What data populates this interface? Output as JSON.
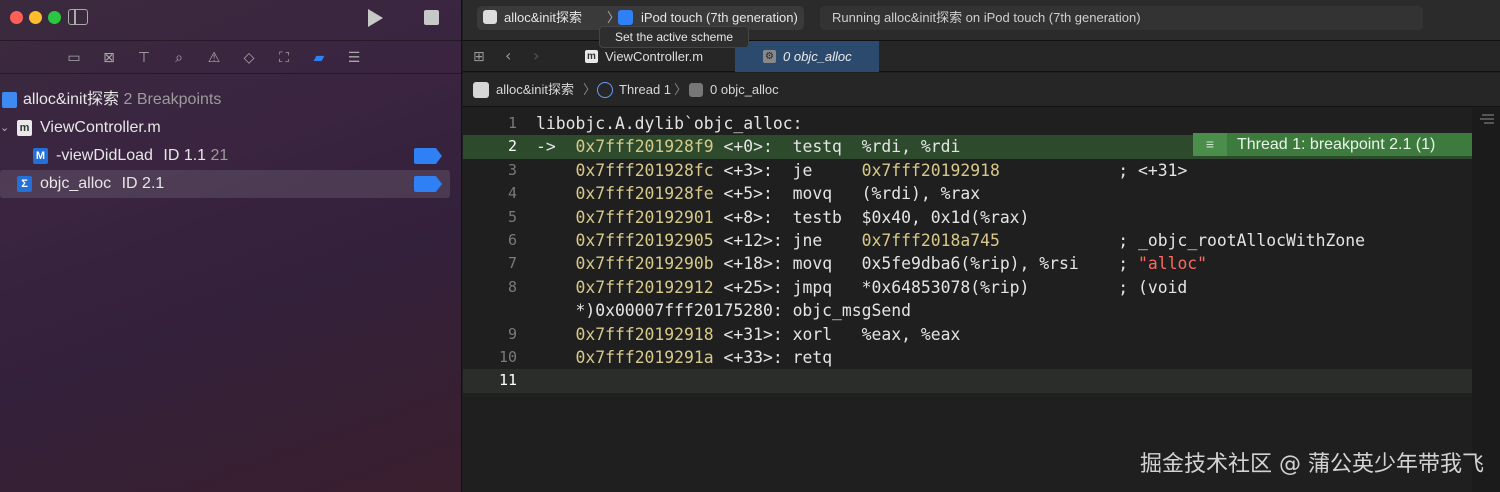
{
  "window": {
    "title": "alloc&init探索"
  },
  "navigator": {
    "toolbar_icons": [
      "folder-icon",
      "source-control-icon",
      "hierarchy-icon",
      "search-icon",
      "issue-warning-icon",
      "test-diamond-icon",
      "debug-spray-icon",
      "breakpoint-navigator-icon",
      "report-icon"
    ],
    "project": {
      "name": "alloc&init探索",
      "subtitle": "2 Breakpoints"
    },
    "file": {
      "name": "ViewController.m"
    },
    "breakpoints": [
      {
        "method": "-viewDidLoad",
        "id": "ID 1.1",
        "line": "21"
      },
      {
        "method": "objc_alloc",
        "id": "ID 2.1",
        "line": ""
      }
    ]
  },
  "toolbar": {
    "scheme": "alloc&init探索",
    "separator": "〉",
    "device": "iPod touch (7th generation)",
    "status": "Running alloc&init探索 on iPod touch (7th generation)",
    "tooltip": "Set the active scheme"
  },
  "tabs": [
    {
      "label": "ViewController.m",
      "active": false
    },
    {
      "label": "0 objc_alloc",
      "active": true
    }
  ],
  "jump_bar": {
    "project": "alloc&init探索",
    "thread": "Thread 1",
    "frame": "0 objc_alloc",
    "sep": "〉"
  },
  "code": {
    "lines": [
      {
        "n": "1",
        "text": "libobjc.A.dylib`objc_alloc:"
      },
      {
        "n": "2",
        "arrow": "->",
        "addr": "0x7fff201928f9",
        "rest": " <+0>:  testq  %rdi, %rdi"
      },
      {
        "n": "3",
        "addr": "0x7fff201928fc",
        "rest": " <+3>:  je     ",
        "addr2": "0x7fff20192918",
        "rest2": "            ; <+31>"
      },
      {
        "n": "4",
        "addr": "0x7fff201928fe",
        "rest": " <+5>:  movq   (%rdi), %rax"
      },
      {
        "n": "5",
        "addr": "0x7fff20192901",
        "rest": " <+8>:  testb  $0x40, 0x1d(%rax)"
      },
      {
        "n": "6",
        "addr": "0x7fff20192905",
        "rest": " <+12>: jne    ",
        "addr2": "0x7fff2018a745",
        "rest2": "            ; _objc_rootAllocWithZone"
      },
      {
        "n": "7",
        "addr": "0x7fff2019290b",
        "rest": " <+18>: movq   0x5fe9dba6(%rip), %rsi    ; ",
        "str": "\"alloc\""
      },
      {
        "n": "8",
        "addr": "0x7fff20192912",
        "rest": " <+25>: jmpq   *0x64853078(%rip)         ; (void"
      },
      {
        "n": "",
        "cont": "    *)0x00007fff20175280: objc_msgSend"
      },
      {
        "n": "9",
        "addr": "0x7fff20192918",
        "rest": " <+31>: xorl   %eax, %eax"
      },
      {
        "n": "10",
        "addr": "0x7fff2019291a",
        "rest": " <+33>: retq"
      },
      {
        "n": "11",
        "text": ""
      }
    ],
    "breakpoint_label": "Thread 1: breakpoint 2.1 (1)"
  },
  "watermark": "掘金技术社区 @ 蒲公英少年带我飞"
}
